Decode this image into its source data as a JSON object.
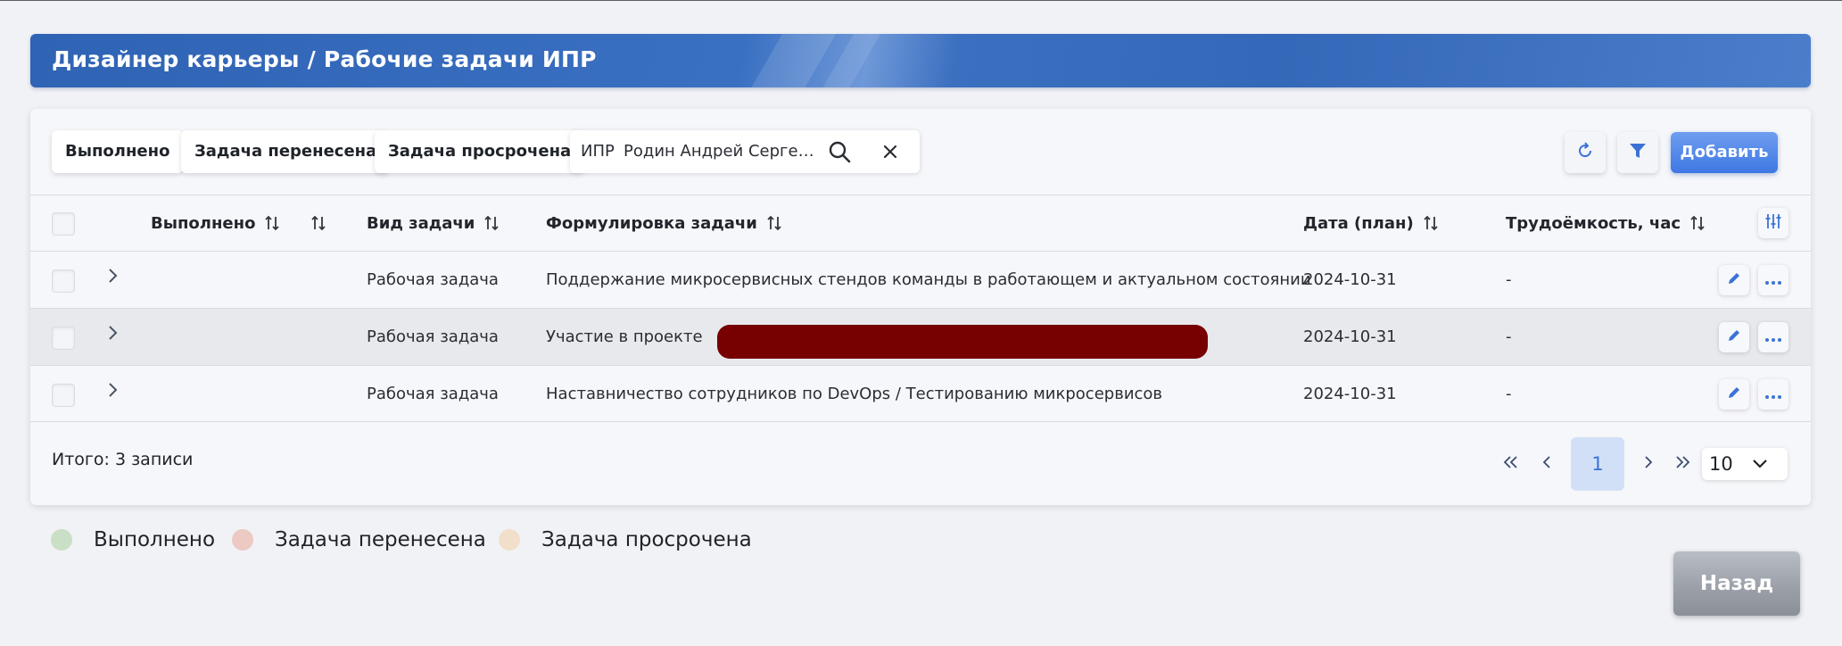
{
  "header": {
    "title": "Дизайнер карьеры / Рабочие задачи ИПР"
  },
  "toolbar": {
    "chips": [
      "Выполнено",
      "Задача перенесена",
      "Задача просрочена"
    ],
    "filter": {
      "tag": "ИПР",
      "value": "Родин Андрей Сергеевич"
    },
    "add_label": "Добавить",
    "icons": {
      "refresh": "refresh-icon",
      "filter": "funnel-icon",
      "clear": "close-icon",
      "search": "search-icon"
    }
  },
  "table": {
    "headers": {
      "done": "Выполнено",
      "type": "Вид задачи",
      "wording": "Формулировка задачи",
      "date": "Дата (план)",
      "effort": "Трудоёмкость, час"
    },
    "rows": [
      {
        "type": "Рабочая задача",
        "wording": "Поддержание микросервисных стендов команды в работающем и актуальном состоянии",
        "date": "2024-10-31",
        "effort": "-"
      },
      {
        "type": "Рабочая задача",
        "wording": "Участие в проекте",
        "date": "2024-10-31",
        "effort": "-"
      },
      {
        "type": "Рабочая задача",
        "wording": "Наставничество сотрудников по DevOps / Тестированию микросервисов",
        "date": "2024-10-31",
        "effort": "-"
      }
    ]
  },
  "footer": {
    "total": "Итого: 3 записи",
    "current_page": "1",
    "page_size": "10"
  },
  "legend": [
    {
      "label": "Выполнено",
      "color": "#c9dfc6"
    },
    {
      "label": "Задача перенесена",
      "color": "#ecc9c3"
    },
    {
      "label": "Задача просрочена",
      "color": "#f1dfca"
    }
  ],
  "back_label": "Назад",
  "colors": {
    "accent": "#3e78e3",
    "header": "#3468b8"
  }
}
